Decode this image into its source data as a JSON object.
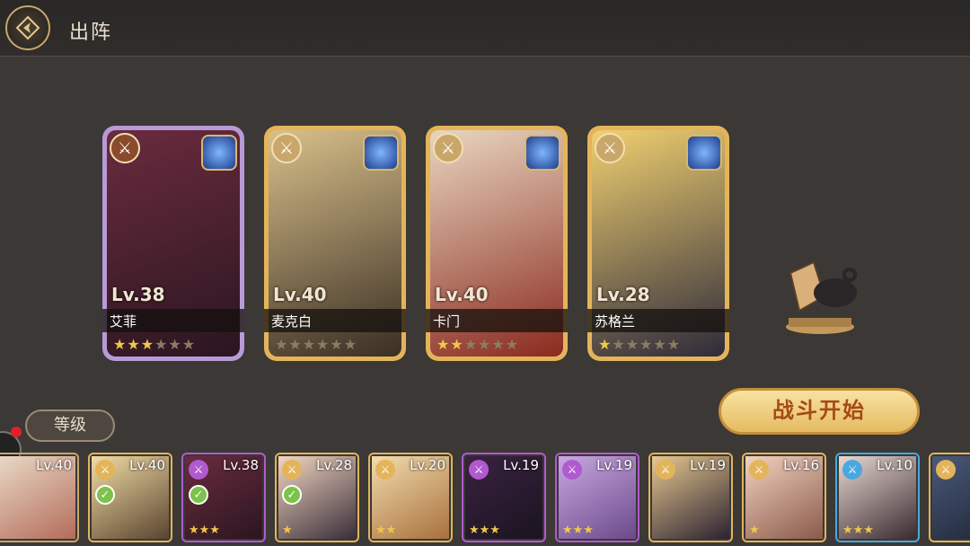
{
  "header": {
    "title": "出阵",
    "back_icon": "compass-back-icon"
  },
  "party": [
    {
      "level": "Lv.38",
      "name": "艾菲",
      "stars_filled": 3,
      "stars_total": 6,
      "frame_color": "#b79ad6",
      "art": [
        "#6a2b3e",
        "#2a1620"
      ],
      "role_color": "#8a4a2e"
    },
    {
      "level": "Lv.40",
      "name": "麦克白",
      "stars_filled": 0,
      "stars_total": 6,
      "frame_color": "#e4b45a",
      "art": [
        "#d8c08a",
        "#3a2e24"
      ],
      "role_color": "#c9a66a"
    },
    {
      "level": "Lv.40",
      "name": "卡门",
      "stars_filled": 2,
      "stars_total": 6,
      "frame_color": "#e4b45a",
      "art": [
        "#e8d6c0",
        "#8a2a1e"
      ],
      "role_color": "#c9a66a"
    },
    {
      "level": "Lv.28",
      "name": "苏格兰",
      "stars_filled": 1,
      "stars_total": 6,
      "frame_color": "#e4b45a",
      "art": [
        "#f0d070",
        "#2e2a3a"
      ],
      "role_color": "#c9a66a"
    }
  ],
  "actions": {
    "start_battle": "战斗开始",
    "sort_label": "等级"
  },
  "roster": [
    {
      "level": "Lv.40",
      "stars": "",
      "selected": false,
      "border": "#c9a66a",
      "art": [
        "#e9d9c6",
        "#b46c5a"
      ]
    },
    {
      "level": "Lv.40",
      "stars": "",
      "selected": true,
      "border": "#e4b45a",
      "art": [
        "#f1dca4",
        "#5a4430"
      ]
    },
    {
      "level": "Lv.38",
      "stars": "★★★",
      "selected": true,
      "border": "#b05ad0",
      "art": [
        "#6a2b3e",
        "#2a1620"
      ]
    },
    {
      "level": "Lv.28",
      "stars": "★",
      "selected": true,
      "border": "#e4b45a",
      "art": [
        "#f2d6c0",
        "#3a2e3a"
      ]
    },
    {
      "level": "Lv.20",
      "stars": "★★",
      "selected": false,
      "border": "#e4b45a",
      "art": [
        "#f2dcae",
        "#a8703c"
      ]
    },
    {
      "level": "Lv.19",
      "stars": "★★★",
      "selected": false,
      "border": "#b05ad0",
      "art": [
        "#3a2240",
        "#1a1420"
      ]
    },
    {
      "level": "Lv.19",
      "stars": "★★★",
      "selected": false,
      "border": "#b05ad0",
      "art": [
        "#c9a8e0",
        "#6a4a8a"
      ]
    },
    {
      "level": "Lv.19",
      "stars": "",
      "selected": false,
      "border": "#e4b45a",
      "art": [
        "#e8c890",
        "#2a2230"
      ]
    },
    {
      "level": "Lv.16",
      "stars": "★",
      "selected": false,
      "border": "#e4b45a",
      "art": [
        "#f2d2c0",
        "#8a5a4a"
      ]
    },
    {
      "level": "Lv.10",
      "stars": "★★★",
      "selected": false,
      "border": "#4aa8e0",
      "art": [
        "#e8d8d0",
        "#3a2a30"
      ]
    },
    {
      "level": "",
      "stars": "",
      "selected": false,
      "border": "#e4b45a",
      "art": [
        "#4a5a7a",
        "#1e2434"
      ]
    }
  ]
}
